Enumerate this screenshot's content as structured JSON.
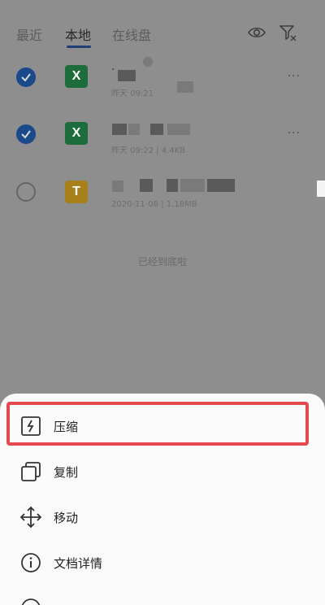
{
  "tabs": [
    {
      "label": "最近"
    },
    {
      "label": "本地"
    },
    {
      "label": "在线盘"
    }
  ],
  "top_icons": {
    "visibility": "eye-icon",
    "filter": "filter-icon"
  },
  "files": [
    {
      "type": "xlsx",
      "icon_letter": "X",
      "name": "·",
      "meta": "昨天 09:21",
      "selected": true,
      "more": "···"
    },
    {
      "type": "xlsx",
      "icon_letter": "X",
      "name": "",
      "meta": "昨天 09:22 | 4.4KB",
      "selected": true,
      "more": "···"
    },
    {
      "type": "ppt",
      "icon_letter": "T",
      "name": "",
      "meta": "2020-11-08 | 1.18MB",
      "selected": false,
      "more": ""
    }
  ],
  "end_note": "已经到底啦",
  "menu": [
    {
      "label": "压缩",
      "icon": "compress-icon",
      "highlighted": true
    },
    {
      "label": "复制",
      "icon": "copy-icon"
    },
    {
      "label": "移动",
      "icon": "move-icon"
    },
    {
      "label": "文档详情",
      "icon": "info-icon"
    }
  ],
  "colors": {
    "highlight": "#e5484f",
    "accent": "#1b4a8a",
    "excel": "#1d6c3b",
    "ppt": "#a8801a"
  }
}
